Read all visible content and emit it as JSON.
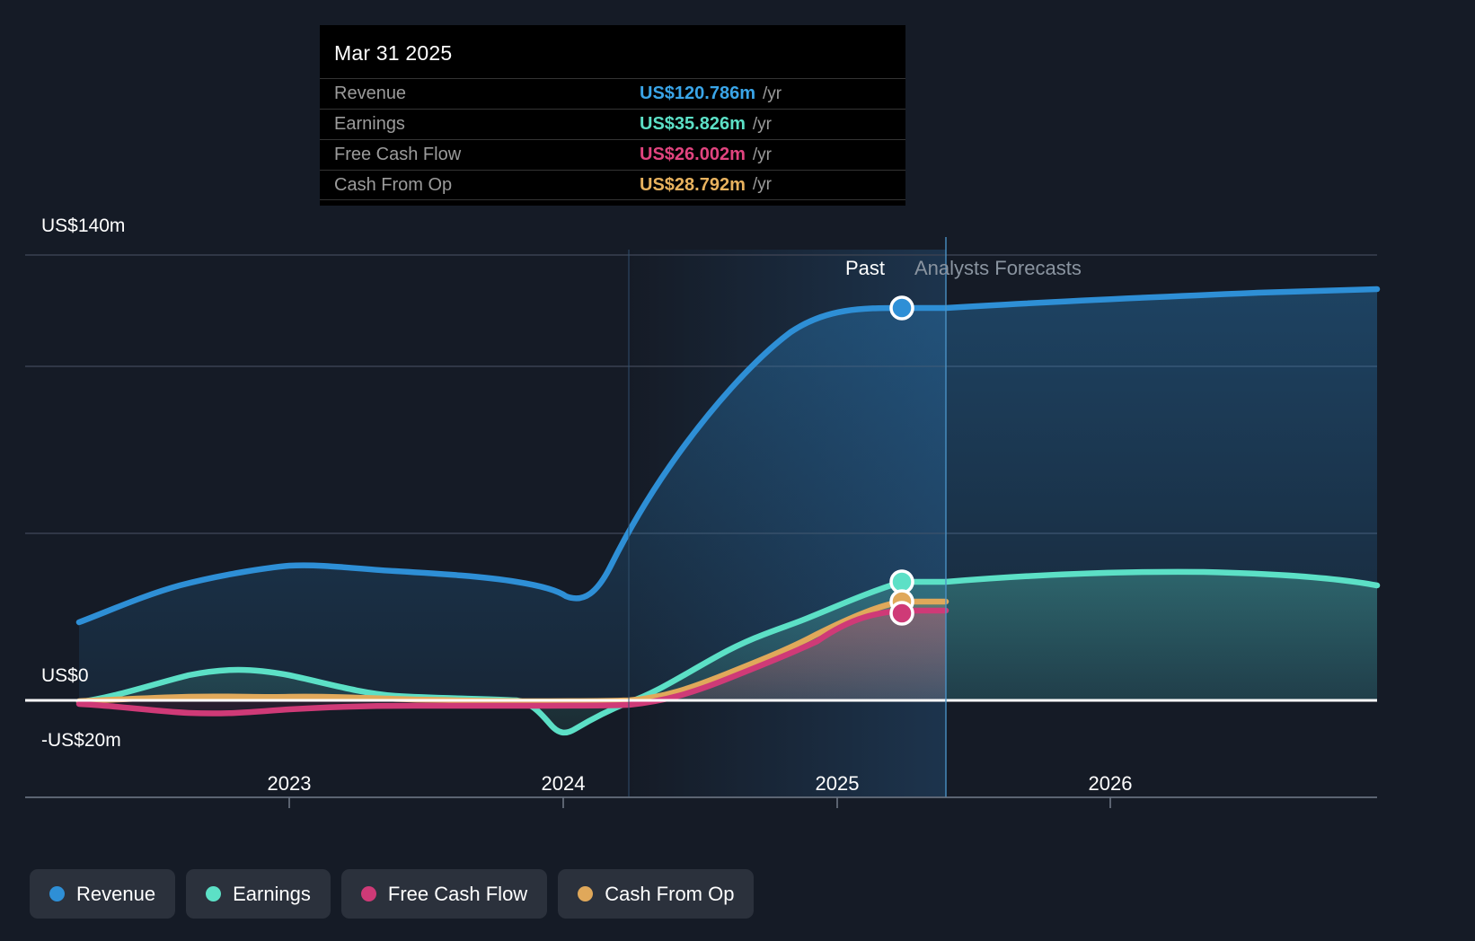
{
  "tooltip": {
    "date": "Mar 31 2025",
    "rows": [
      {
        "label": "Revenue",
        "value": "US$120.786m",
        "unit": "/yr",
        "color": "#3aa5e8"
      },
      {
        "label": "Earnings",
        "value": "US$35.826m",
        "unit": "/yr",
        "color": "#5ce0c6"
      },
      {
        "label": "Free Cash Flow",
        "value": "US$26.002m",
        "unit": "/yr",
        "color": "#e1447f"
      },
      {
        "label": "Cash From Op",
        "value": "US$28.792m",
        "unit": "/yr",
        "color": "#e8b25e"
      }
    ]
  },
  "phases": {
    "past": "Past",
    "forecast": "Analysts Forecasts"
  },
  "legend": [
    {
      "label": "Revenue",
      "color": "#2e8fd6"
    },
    {
      "label": "Earnings",
      "color": "#5ce0c6"
    },
    {
      "label": "Free Cash Flow",
      "color": "#cf3a77"
    },
    {
      "label": "Cash From Op",
      "color": "#e0a85a"
    }
  ],
  "chart_data": {
    "type": "area",
    "title": "",
    "xlabel": "",
    "ylabel": "",
    "currency": "US$",
    "unit": "m",
    "ylim": [
      -20,
      140
    ],
    "ytick_labels": [
      "US$140m",
      "US$0",
      "-US$20m"
    ],
    "ytick_values": [
      140,
      0,
      -20
    ],
    "gridlines": [
      140,
      105,
      70,
      35,
      -20
    ],
    "xtick_labels": [
      "2023",
      "2024",
      "2025",
      "2026"
    ],
    "xtick_values": [
      2023.0,
      2024.0,
      2025.0,
      2026.0
    ],
    "xlim": [
      2022.22,
      2027.0
    ],
    "forecast_start": 2025.25,
    "grid": true,
    "legend_position": "bottom-left",
    "highlight": {
      "x": 2025.25,
      "date": "Mar 31 2025"
    },
    "series": [
      {
        "name": "Revenue",
        "color": "#2e8fd6",
        "marker_value": 120.786,
        "x": [
          2022.22,
          2022.5,
          2022.75,
          2023.0,
          2023.25,
          2023.5,
          2023.75,
          2024.0,
          2024.25,
          2024.5,
          2024.75,
          2025.0,
          2025.25,
          2025.75,
          2026.25,
          2026.75,
          2027.0
        ],
        "values": [
          24.5,
          30.5,
          35.2,
          36.6,
          36.0,
          36.5,
          37.0,
          34.8,
          41.0,
          62.0,
          88.0,
          110.0,
          120.786,
          122.5,
          124.0,
          125.4,
          126.0
        ]
      },
      {
        "name": "Earnings",
        "color": "#5ce0c6",
        "marker_value": 35.826,
        "x": [
          2022.22,
          2022.5,
          2022.75,
          2023.0,
          2023.25,
          2023.5,
          2023.75,
          2024.0,
          2024.25,
          2024.5,
          2024.75,
          2025.0,
          2025.25,
          2025.75,
          2026.25,
          2026.75,
          2027.0
        ],
        "values": [
          -0.6,
          3.0,
          5.6,
          4.5,
          2.2,
          1.0,
          0.2,
          -12.5,
          -7.0,
          -1.5,
          5.0,
          24.0,
          35.826,
          38.5,
          39.5,
          38.0,
          36.5
        ]
      },
      {
        "name": "Free Cash Flow",
        "color": "#cf3a77",
        "marker_value": 26.002,
        "x": [
          2022.22,
          2022.5,
          2022.75,
          2023.0,
          2023.25,
          2023.5,
          2023.75,
          2024.0,
          2024.25,
          2024.5,
          2024.75,
          2025.0,
          2025.25
        ],
        "values": [
          -0.8,
          -2.0,
          -3.5,
          -2.4,
          -1.5,
          -1.2,
          -1.4,
          -1.6,
          -1.0,
          5.5,
          14.5,
          22.0,
          26.002
        ]
      },
      {
        "name": "Cash From Op",
        "color": "#e0a85a",
        "marker_value": 28.792,
        "x": [
          2022.22,
          2022.5,
          2022.75,
          2023.0,
          2023.25,
          2023.5,
          2023.75,
          2024.0,
          2024.25,
          2024.5,
          2024.75,
          2025.0,
          2025.25
        ],
        "values": [
          -0.2,
          0.4,
          1.0,
          1.2,
          0.9,
          0.6,
          0.4,
          0.2,
          1.2,
          8.0,
          17.0,
          25.0,
          28.792
        ]
      }
    ]
  }
}
